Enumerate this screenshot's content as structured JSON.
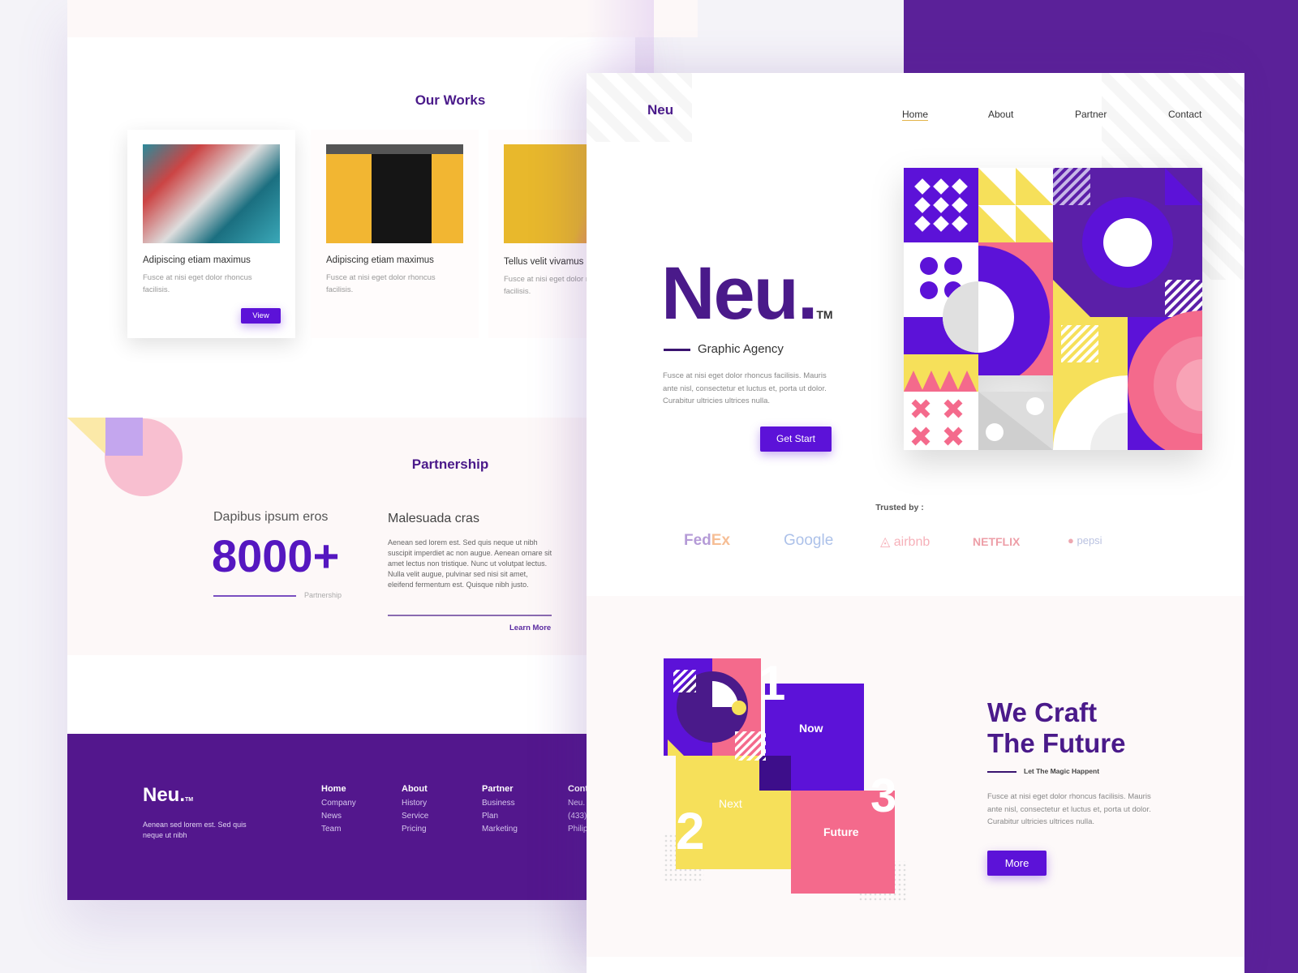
{
  "colors": {
    "primary": "#5c12d8",
    "dark_purple": "#4a1a8a",
    "footer": "#53178d",
    "band": "#5b2199",
    "yellow": "#f6e05a",
    "pink": "#f46a8c"
  },
  "works": {
    "title": "Our Works",
    "cards": [
      {
        "title": "Adipiscing etiam maximus",
        "desc": "Fusce at nisi eget dolor rhoncus facilisis.",
        "button": "View"
      },
      {
        "title": "Adipiscing etiam maximus",
        "desc": "Fusce at nisi eget dolor rhoncus facilisis."
      },
      {
        "title": "Tellus velit vivamus",
        "desc": "Fusce at nisi eget dolor rhoncus facilisis."
      }
    ]
  },
  "partnership": {
    "title": "Partnership",
    "stat_label": "Dapibus ipsum eros",
    "stat_value": "8000+",
    "stat_caption": "Partnership",
    "heading": "Malesuada cras",
    "body": "Aenean sed lorem est. Sed quis neque ut nibh suscipit imperdiet ac non augue. Aenean ornare sit amet lectus non tristique. Nunc ut volutpat lectus. Nulla velit augue, pulvinar sed nisi sit amet, eleifend fermentum est. Quisque nibh justo.",
    "link": "Learn More"
  },
  "footer": {
    "brand": "Neu.",
    "tm": "TM",
    "tagline": "Aenean sed lorem est. Sed quis neque ut nibh",
    "columns": [
      {
        "heading": "Home",
        "items": [
          "Company",
          "News",
          "Team"
        ]
      },
      {
        "heading": "About",
        "items": [
          "History",
          "Service",
          "Pricing"
        ]
      },
      {
        "heading": "Partner",
        "items": [
          "Business",
          "Plan",
          "Marketing"
        ]
      },
      {
        "heading": "Cont",
        "items": [
          "Neu.",
          "(433)",
          "Philip"
        ]
      }
    ]
  },
  "nav": {
    "brand": "Neu",
    "items": [
      "Home",
      "About",
      "Partner",
      "Contact"
    ],
    "active": "Home"
  },
  "hero": {
    "title": "Neu",
    "tm": "TM",
    "subtitle": "Graphic Agency",
    "body": "Fusce at nisi eget dolor rhoncus facilisis. Mauris ante nisl, consectetur et luctus et, porta ut dolor. Curabitur ultricies ultrices nulla.",
    "button": "Get Start"
  },
  "trusted": {
    "label": "Trusted by :",
    "logos": [
      "FedEx",
      "Google",
      "airbnb",
      "NETFLIX",
      "pepsi"
    ]
  },
  "craft": {
    "title_line1": "We Craft",
    "title_line2": "The Future",
    "tagline": "Let The Magic Happent",
    "body": "Fusce at nisi eget dolor rhoncus facilisis. Mauris ante nisl, consectetur et luctus et, porta ut dolor. Curabitur ultricies ultrices nulla.",
    "button": "More",
    "steps": [
      {
        "num": "1",
        "label": "Now"
      },
      {
        "num": "2",
        "label": "Next"
      },
      {
        "num": "3",
        "label": "Future"
      }
    ]
  }
}
